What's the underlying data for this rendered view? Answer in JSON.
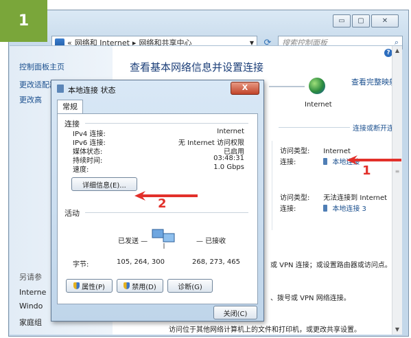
{
  "step_badge": "1",
  "window": {
    "breadcrumb_prefix": "«",
    "breadcrumb_1": "网络和 Internet",
    "breadcrumb_sep": "▸",
    "breadcrumb_2": "网络和共享中心",
    "search_placeholder": "搜索控制面板"
  },
  "sidebar": {
    "home": "控制面板主页",
    "link_2": "更改适配器设置",
    "link_3": "更改高",
    "see_also": "另请参",
    "internet": "Interne",
    "windows": "Windo",
    "homegroup": "家庭组"
  },
  "main": {
    "title": "查看基本网络信息并设置连接",
    "full_map": "查看完整映射",
    "internet_label": "Internet",
    "connect_disconnect": "连接或断开连接",
    "net1_access_key": "访问类型:",
    "net1_access_val": "Internet",
    "net1_conn_key": "连接:",
    "net1_conn_val": "本地连接",
    "net2_access_key": "访问类型:",
    "net2_access_val": "无法连接到 Internet",
    "net2_conn_key": "连接:",
    "net2_conn_val": "本地连接 3",
    "text_vpn": "或 VPN 连接；或设置路由器或访问点。",
    "text_dial": "、拨号或 VPN 网络连接。",
    "text_share": "访问位于其他网络计算机上的文件和打印机，或更改共享设置。"
  },
  "dialog": {
    "title": "本地连接 状态",
    "close_label": "X",
    "tab": "常规",
    "conn_group": "连接",
    "rows": [
      {
        "key": "IPv4 连接:",
        "val": "Internet"
      },
      {
        "key": "IPv6 连接:",
        "val": "无 Internet 访问权限"
      },
      {
        "key": "媒体状态:",
        "val": "已启用"
      },
      {
        "key": "持续时间:",
        "val": "03:48:31"
      },
      {
        "key": "速度:",
        "val": "1.0 Gbps"
      }
    ],
    "details_btn": "详细信息(E)...",
    "activity_group": "活动",
    "sent_label": "已发送 —",
    "recv_label": "— 已接收",
    "bytes_label": "字节:",
    "bytes_sent": "105, 264, 300",
    "bytes_recv": "268, 273, 465",
    "props_btn": "属性(P)",
    "disable_btn": "禁用(D)",
    "diagnose_btn": "诊断(G)",
    "close_btn": "关闭(C)"
  },
  "annotations": {
    "num_1": "1",
    "num_2": "2",
    "color": "#e2302a"
  }
}
